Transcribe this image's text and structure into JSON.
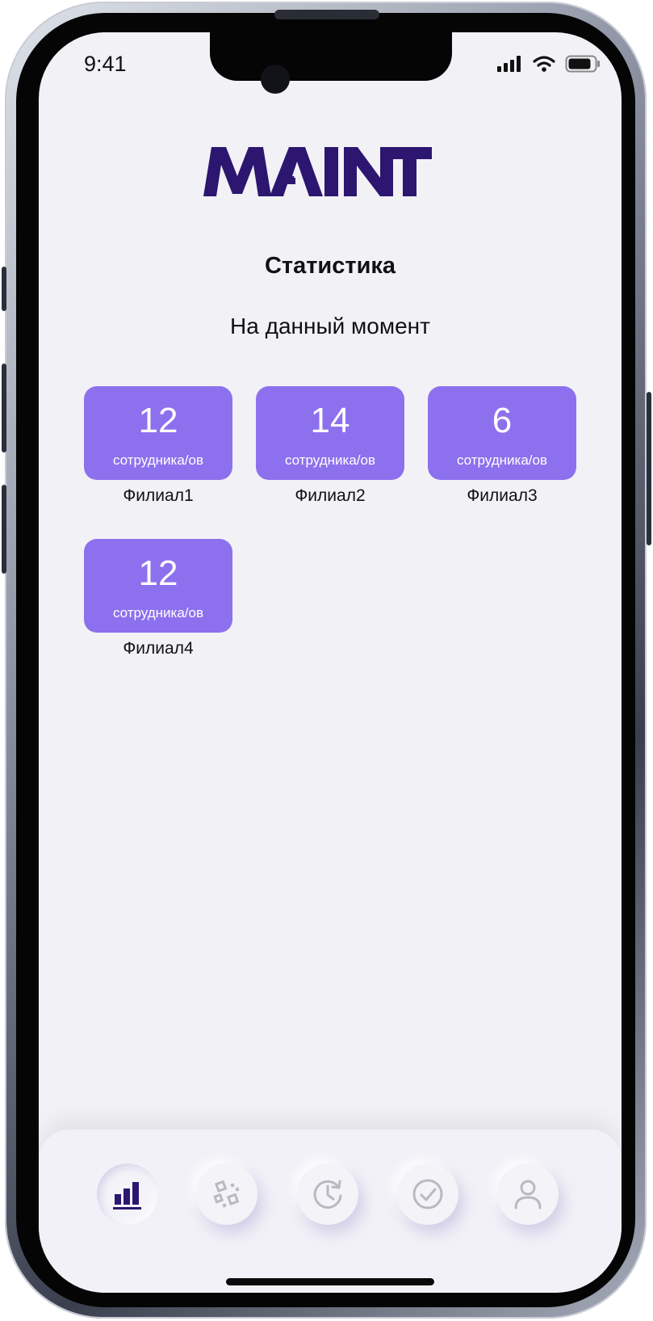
{
  "status_bar": {
    "time": "9:41"
  },
  "logo_text": "MAINT",
  "page": {
    "title": "Статистика",
    "subtitle": "На данный момент"
  },
  "branches": [
    {
      "count": "12",
      "unit": "сотрудника/ов",
      "name": "Филиал1"
    },
    {
      "count": "14",
      "unit": "сотрудника/ов",
      "name": "Филиал2"
    },
    {
      "count": "6",
      "unit": "сотрудника/ов",
      "name": "Филиал3"
    },
    {
      "count": "12",
      "unit": "сотрудника/ов",
      "name": "Филиал4"
    }
  ],
  "tab_bar": {
    "active": "statistics",
    "items": [
      {
        "icon": "bar-chart-icon"
      },
      {
        "icon": "qr-code-icon"
      },
      {
        "icon": "history-icon"
      },
      {
        "icon": "check-circle-icon"
      },
      {
        "icon": "user-icon"
      }
    ]
  },
  "colors": {
    "accent": "#8d70ee",
    "brand": "#2c1670",
    "background": "#f2f1f6",
    "inactive_icon": "#b9b9c0"
  }
}
